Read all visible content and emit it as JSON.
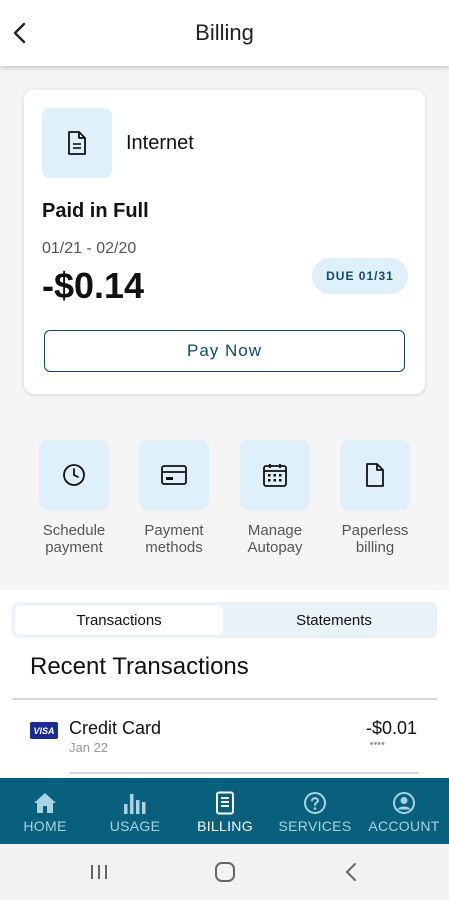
{
  "header": {
    "title": "Billing",
    "back_icon": "chevron-left-icon"
  },
  "bill": {
    "service_name": "Internet",
    "service_icon": "document-icon",
    "status": "Paid in Full",
    "period": "01/21 - 02/20",
    "amount": "-$0.14",
    "due_badge": "DUE 01/31",
    "pay_button": "Pay Now"
  },
  "actions": [
    {
      "icon": "clock-icon",
      "line1": "Schedule",
      "line2": "payment"
    },
    {
      "icon": "credit-card-icon",
      "line1": "Payment",
      "line2": "methods"
    },
    {
      "icon": "calendar-icon",
      "line1": "Manage",
      "line2": "Autopay"
    },
    {
      "icon": "file-icon",
      "line1": "Paperless",
      "line2": "billing"
    }
  ],
  "tabs": {
    "active": "Transactions",
    "inactive": "Statements"
  },
  "transactions": {
    "title": "Recent Transactions",
    "items": [
      {
        "card_brand": "VISA",
        "name": "Credit Card",
        "date": "Jan 22",
        "amount": "-$0.01",
        "mask": "••••"
      }
    ]
  },
  "bottom_nav": [
    {
      "icon": "home-icon",
      "label": "HOME",
      "active": false
    },
    {
      "icon": "bar-chart-icon",
      "label": "USAGE",
      "active": false
    },
    {
      "icon": "bill-icon",
      "label": "BILLING",
      "active": true
    },
    {
      "icon": "help-circle-icon",
      "label": "SERVICES",
      "active": false
    },
    {
      "icon": "account-icon",
      "label": "ACCOUNT",
      "active": false
    }
  ],
  "colors": {
    "primary": "#08607d",
    "accent_dark": "#0d4a6b",
    "icon_tile": "#dff0fb"
  }
}
